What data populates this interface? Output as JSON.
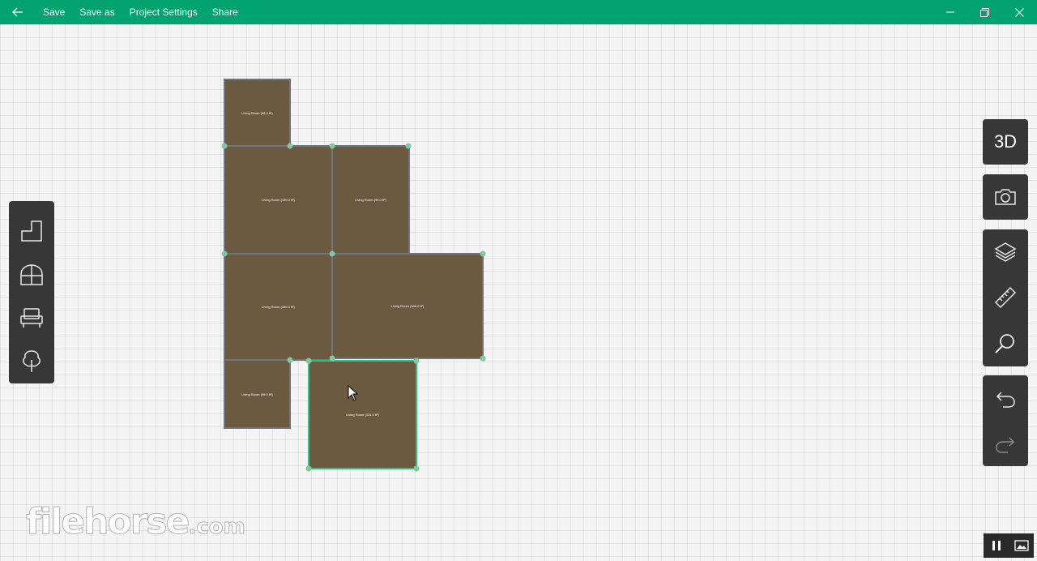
{
  "titlebar": {
    "menu": [
      {
        "label": "Save"
      },
      {
        "label": "Save as"
      },
      {
        "label": "Project Settings"
      },
      {
        "label": "Share"
      }
    ],
    "back_icon": "arrow-left-icon",
    "window_controls": [
      "minimize-icon",
      "restore-icon",
      "close-icon"
    ],
    "color": "#00a36e"
  },
  "left_toolbar": {
    "tools": [
      "wall-tool-icon",
      "window-tool-icon",
      "furniture-tool-icon",
      "tree-tool-icon"
    ]
  },
  "right_toolbar": {
    "view_3d_label": "3D",
    "tools": [
      "camera-icon",
      "layers-icon",
      "ruler-icon",
      "search-icon",
      "undo-icon",
      "redo-icon"
    ]
  },
  "rooms": [
    {
      "id": "r1",
      "label": "Living Room (99.0 ft²)"
    },
    {
      "id": "r2",
      "label": "Living Room (159.0 ft²)"
    },
    {
      "id": "r3",
      "label": "Living Room (99.0 ft²)"
    },
    {
      "id": "r4",
      "label": "Living Room (169.0 ft²)"
    },
    {
      "id": "r5",
      "label": "Living Room (165.0 ft²)"
    },
    {
      "id": "r6",
      "label": "Living Room (99.0 ft²)"
    },
    {
      "id": "r7",
      "label": "Living Room (131.0 ft²)"
    }
  ],
  "watermark": {
    "text": "filehorse",
    "suffix": ".com"
  },
  "colors": {
    "room_fill": "#6b5a40",
    "wall": "#6e7480",
    "selected": "#2bc48a",
    "toolbar": "#373737"
  }
}
